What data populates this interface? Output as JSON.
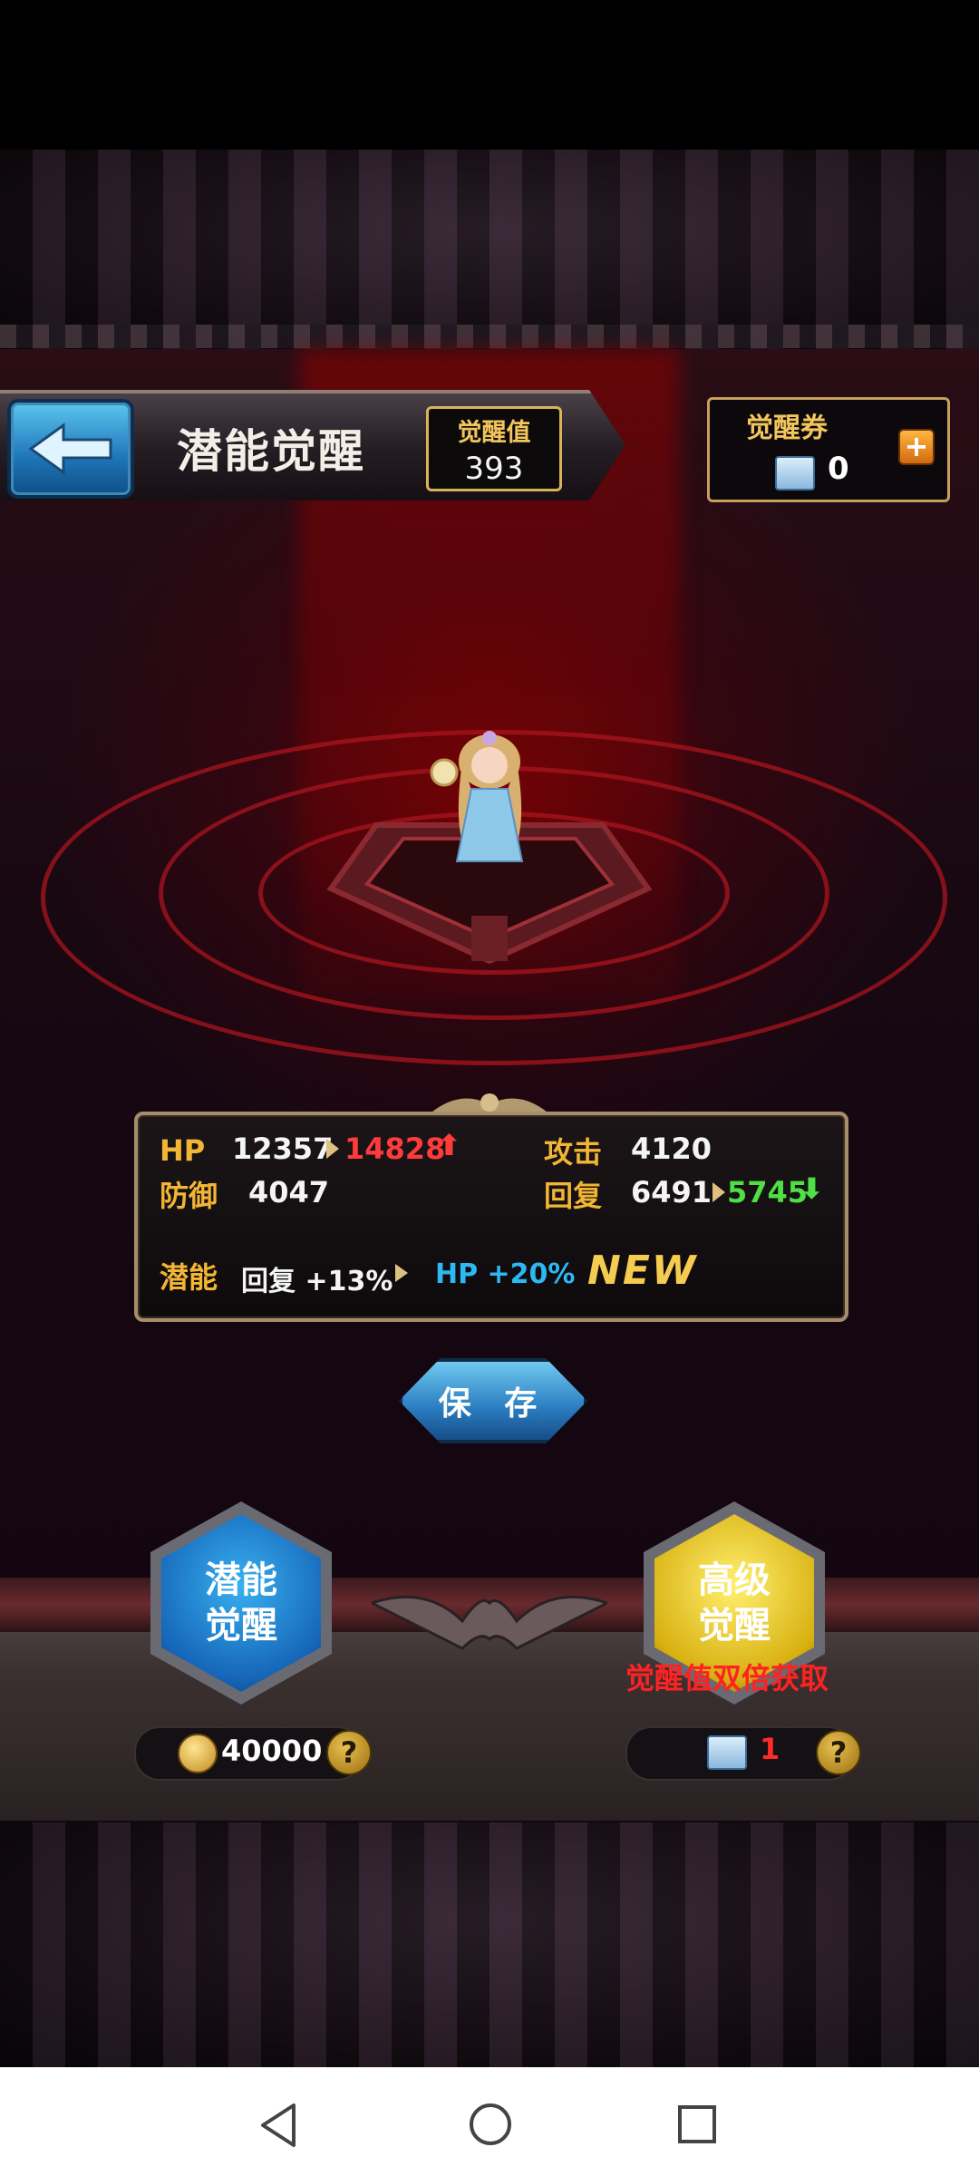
{
  "header": {
    "title": "潜能觉醒",
    "awaken_value_label": "觉醒值",
    "awaken_value": "393",
    "ticket_label": "觉醒券",
    "ticket_count": "0"
  },
  "stats": {
    "hp_label": "HP",
    "hp_old": "12357",
    "hp_new": "14828",
    "attack_label": "攻击",
    "attack_value": "4120",
    "defense_label": "防御",
    "defense_value": "4047",
    "recover_label": "回复",
    "recover_old": "6491",
    "recover_new": "5745",
    "potential_label": "潜能",
    "potential_old": "回复 +13%",
    "potential_new": "HP +20%",
    "new_badge": "NEW"
  },
  "save_label": "保 存",
  "awaken_options": {
    "basic_line1": "潜能",
    "basic_line2": "觉醒",
    "basic_cost": "40000",
    "advanced_line1": "高级",
    "advanced_line2": "觉醒",
    "advanced_note": "觉醒值双倍获取",
    "advanced_cost": "1"
  },
  "question_mark": "?",
  "colors": {
    "gold": "#f2b634",
    "increase": "#ff3b3b",
    "decrease": "#4ee044",
    "potential_new": "#2eb8f2"
  }
}
